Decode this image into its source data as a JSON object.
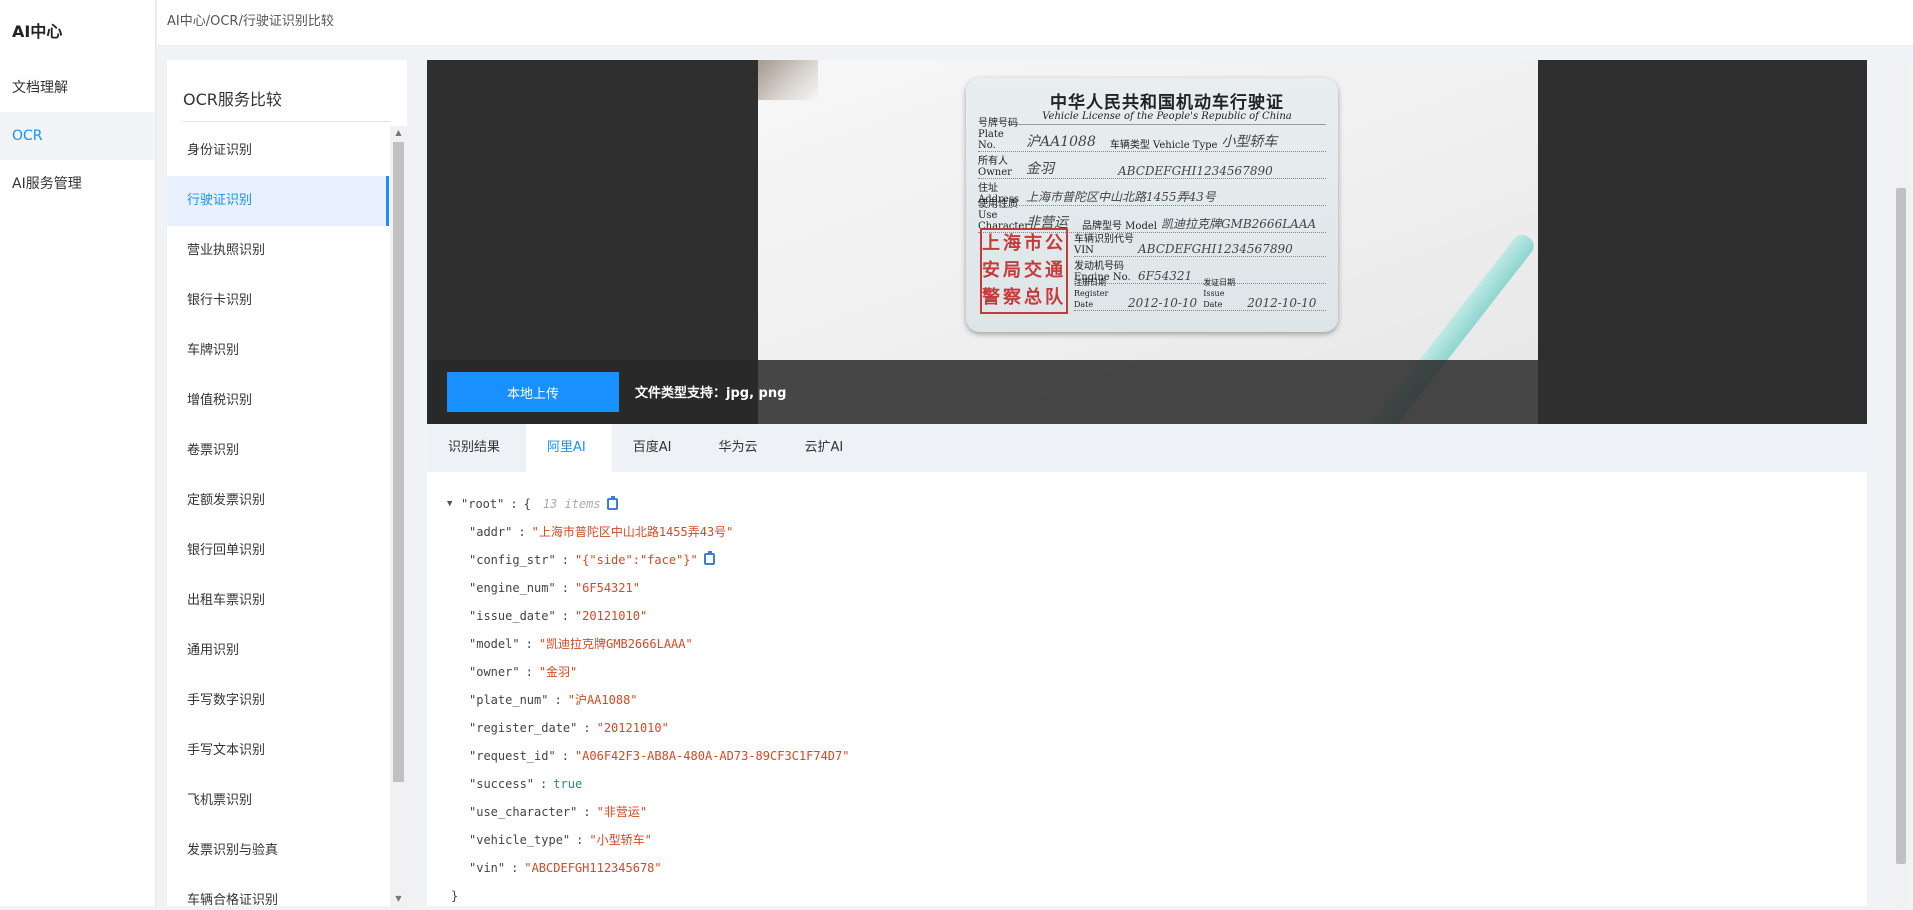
{
  "app": {
    "title": "AI中心",
    "nav": [
      {
        "label": "文档理解",
        "active": false
      },
      {
        "label": "OCR",
        "active": true
      },
      {
        "label": "AI服务管理",
        "active": false
      }
    ]
  },
  "breadcrumb": "AI中心/OCR/行驶证识别比较",
  "services": {
    "title": "OCR服务比较",
    "items": [
      {
        "label": "身份证识别",
        "active": false
      },
      {
        "label": "行驶证识别",
        "active": true
      },
      {
        "label": "营业执照识别",
        "active": false
      },
      {
        "label": "银行卡识别",
        "active": false
      },
      {
        "label": "车牌识别",
        "active": false
      },
      {
        "label": "增值税识别",
        "active": false
      },
      {
        "label": "卷票识别",
        "active": false
      },
      {
        "label": "定额发票识别",
        "active": false
      },
      {
        "label": "银行回单识别",
        "active": false
      },
      {
        "label": "出租车票识别",
        "active": false
      },
      {
        "label": "通用识别",
        "active": false
      },
      {
        "label": "手写数字识别",
        "active": false
      },
      {
        "label": "手写文本识别",
        "active": false
      },
      {
        "label": "飞机票识别",
        "active": false
      },
      {
        "label": "发票识别与验真",
        "active": false
      },
      {
        "label": "车辆合格证识别",
        "active": false
      }
    ]
  },
  "license": {
    "title": "中华人民共和国机动车行驶证",
    "subtitle": "Vehicle License of the People's Republic of China",
    "plate_label": "号牌号码 Plate No.",
    "plate": "沪AA1088",
    "type_label": "车辆类型 Vehicle Type",
    "type": "小型轿车",
    "owner_label": "所有人 Owner",
    "owner": "金羽",
    "owner_code": "ABCDEFGHI1234567890",
    "address_label": "住址 Address",
    "address": "上海市普陀区中山北路1455弄43号",
    "use_label": "使用性质 Use Character",
    "use": "非营运",
    "model_label": "品牌型号 Model",
    "model": "凯迪拉克牌GMB2666LAAA",
    "stamp": [
      "上海市公",
      "安局交通",
      "警察总队"
    ],
    "vin_label": "车辆识别代号 VIN",
    "vin": "ABCDEFGHI1234567890",
    "engine_label": "发动机号码 Engine No.",
    "engine": "6F54321",
    "register_label": "注册日期 Register Date",
    "register": "2012-10-10",
    "issue_label": "发证日期 Issue Date",
    "issue": "2012-10-10"
  },
  "upload": {
    "button": "本地上传",
    "hint": "文件类型支持：jpg, png"
  },
  "tabs": [
    {
      "label": "识别结果",
      "active": false
    },
    {
      "label": "阿里AI",
      "active": true
    },
    {
      "label": "百度AI",
      "active": false
    },
    {
      "label": "华为云",
      "active": false
    },
    {
      "label": "云扩AI",
      "active": false
    }
  ],
  "json": {
    "root_key": "\"root\"",
    "open_brace": "{",
    "close_brace": "}",
    "count": "13 items",
    "entries": [
      {
        "key": "\"addr\"",
        "value": "\"上海市普陀区中山北路1455弄43号\"",
        "kind": "str"
      },
      {
        "key": "\"config_str\"",
        "value": "\"{\"side\":\"face\"}\"",
        "kind": "str",
        "copy": true
      },
      {
        "key": "\"engine_num\"",
        "value": "\"6F54321\"",
        "kind": "str"
      },
      {
        "key": "\"issue_date\"",
        "value": "\"20121010\"",
        "kind": "str"
      },
      {
        "key": "\"model\"",
        "value": "\"凯迪拉克牌GMB2666LAAA\"",
        "kind": "str"
      },
      {
        "key": "\"owner\"",
        "value": "\"金羽\"",
        "kind": "str"
      },
      {
        "key": "\"plate_num\"",
        "value": "\"沪AA1088\"",
        "kind": "str"
      },
      {
        "key": "\"register_date\"",
        "value": "\"20121010\"",
        "kind": "str"
      },
      {
        "key": "\"request_id\"",
        "value": "\"A06F42F3-AB8A-480A-AD73-89CF3C1F74D7\"",
        "kind": "str"
      },
      {
        "key": "\"success\"",
        "value": "true",
        "kind": "bool"
      },
      {
        "key": "\"use_character\"",
        "value": "\"非营运\"",
        "kind": "str"
      },
      {
        "key": "\"vehicle_type\"",
        "value": "\"小型轿车\"",
        "kind": "str"
      },
      {
        "key": "\"vin\"",
        "value": "\"ABCDEFGH112345678\"",
        "kind": "str"
      }
    ]
  },
  "colors": {
    "accent": "#1890ff",
    "json_string": "#d14a24",
    "json_bool": "#1a8f7a",
    "stamp": "#c63a3a"
  }
}
